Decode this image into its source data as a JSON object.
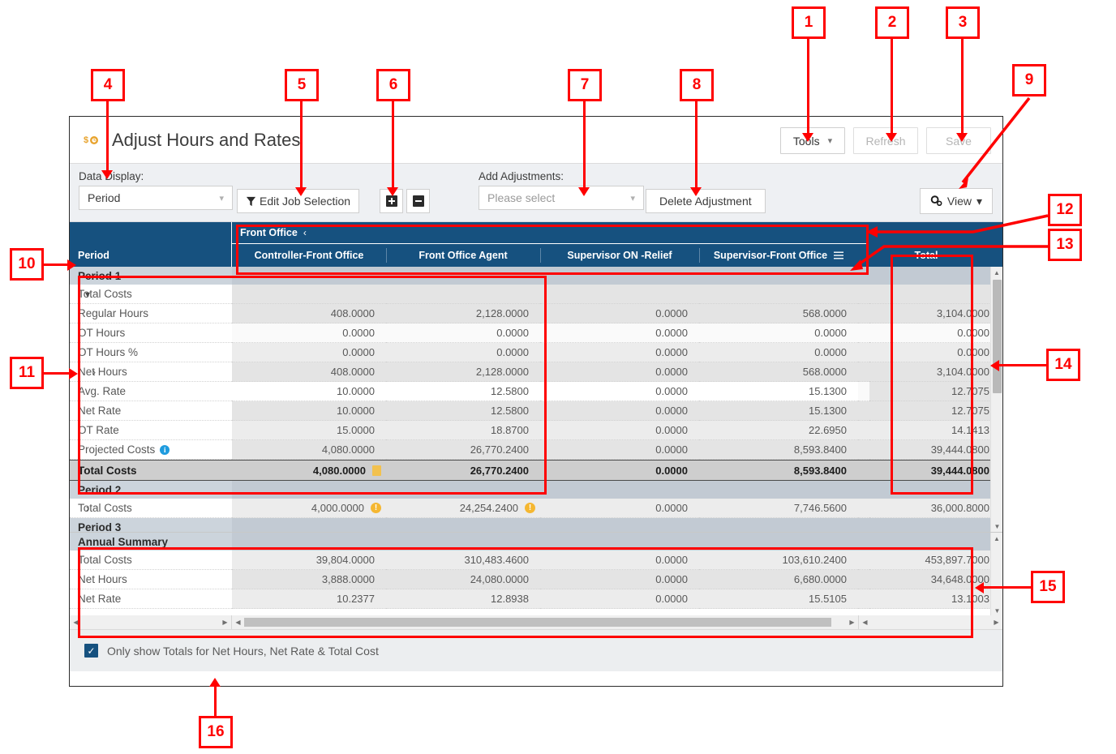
{
  "window": {
    "title": "Adjust Hours and Rates",
    "title_icon": "dollar-clock-icon"
  },
  "titlebar_buttons": {
    "tools": "Tools",
    "refresh": "Refresh",
    "save": "Save"
  },
  "toolbar": {
    "data_display_label": "Data Display:",
    "data_display_value": "Period",
    "edit_job_selection": "Edit Job Selection",
    "add_button_icon": "plus-square-icon",
    "remove_button_icon": "minus-square-icon",
    "add_adjustments_label": "Add Adjustments:",
    "add_adjustments_placeholder": "Please select",
    "delete_adjustment": "Delete Adjustment",
    "view": "View"
  },
  "grid": {
    "group_header": "Front Office",
    "group_collapse_icon": "chevron-left-icon",
    "columns": [
      "Period",
      "Controller-Front Office",
      "Front Office Agent",
      "Supervisor ON -Relief",
      "Supervisor-Front Office",
      "Total"
    ],
    "column_menu_icon": "hamburger-menu-icon",
    "sections": [
      {
        "name": "Period 1",
        "rows": [
          {
            "label": "Total Costs",
            "indent": "tc",
            "expander": "chevron-down-icon",
            "values": [
              "",
              "",
              "",
              "",
              ""
            ],
            "style": "totalcosts-head"
          },
          {
            "label": "Regular Hours",
            "indent": "2",
            "values": [
              "408.0000",
              "2,128.0000",
              "0.0000",
              "568.0000",
              "3,104.0000"
            ],
            "style": "alt"
          },
          {
            "label": "OT Hours",
            "indent": "2",
            "values": [
              "0.0000",
              "0.0000",
              "0.0000",
              "0.0000",
              "0.0000"
            ],
            "style": "white"
          },
          {
            "label": "OT Hours %",
            "indent": "2",
            "values": [
              "0.0000",
              "0.0000",
              "0.0000",
              "0.0000",
              "0.0000"
            ],
            "style": "alt2"
          },
          {
            "label": "Net Hours",
            "indent": "2",
            "expander": "chevron-right-icon",
            "values": [
              "408.0000",
              "2,128.0000",
              "0.0000",
              "568.0000",
              "3,104.0000"
            ],
            "style": "alt"
          },
          {
            "label": "Avg. Rate",
            "indent": "2",
            "values": [
              "10.0000",
              "12.5800",
              "0.0000",
              "15.1300",
              "12.7075"
            ],
            "style": "white"
          },
          {
            "label": "Net Rate",
            "indent": "2",
            "values": [
              "10.0000",
              "12.5800",
              "0.0000",
              "15.1300",
              "12.7075"
            ],
            "style": "alt"
          },
          {
            "label": "OT Rate",
            "indent": "2",
            "values": [
              "15.0000",
              "18.8700",
              "0.0000",
              "22.6950",
              "14.1413"
            ],
            "style": "alt2"
          },
          {
            "label": "Projected Costs",
            "indent": "2",
            "info": true,
            "values": [
              "4,080.0000",
              "26,770.2400",
              "0.0000",
              "8,593.8400",
              "39,444.0800"
            ],
            "style": "alt"
          },
          {
            "label": "Total Costs",
            "indent": "tc",
            "values": [
              "4,080.0000",
              "26,770.2400",
              "0.0000",
              "8,593.8400",
              "39,444.0800"
            ],
            "style": "bold-total",
            "marks": [
              "yellow-square",
              "",
              "",
              "",
              ""
            ]
          }
        ]
      },
      {
        "name": "Period 2",
        "rows": [
          {
            "label": "Total Costs",
            "indent": "tc",
            "expander": "chevron-right-icon",
            "values": [
              "4,000.0000",
              "24,254.2400",
              "0.0000",
              "7,746.5600",
              "36,000.8000"
            ],
            "style": "alt2",
            "marks": [
              "warning",
              "warning",
              "",
              "",
              ""
            ]
          }
        ]
      },
      {
        "name": "Period 3",
        "rows": []
      }
    ],
    "summary": {
      "name": "Annual Summary",
      "rows": [
        {
          "label": "Total Costs",
          "indent": "tc",
          "values": [
            "39,804.0000",
            "310,483.4600",
            "0.0000",
            "103,610.2400",
            "453,897.7000"
          ],
          "style": "alt2"
        },
        {
          "label": "Net Hours",
          "indent": "tc",
          "values": [
            "3,888.0000",
            "24,080.0000",
            "0.0000",
            "6,680.0000",
            "34,648.0000"
          ],
          "style": "alt"
        },
        {
          "label": "Net Rate",
          "indent": "tc",
          "values": [
            "10.2377",
            "12.8938",
            "0.0000",
            "15.5105",
            "13.1003"
          ],
          "style": "alt2"
        }
      ]
    }
  },
  "footer": {
    "checkbox_checked": true,
    "checkbox_label": "Only show Totals for Net Hours, Net Rate & Total Cost"
  },
  "callouts": [
    {
      "n": "1"
    },
    {
      "n": "2"
    },
    {
      "n": "3"
    },
    {
      "n": "4"
    },
    {
      "n": "5"
    },
    {
      "n": "6"
    },
    {
      "n": "7"
    },
    {
      "n": "8"
    },
    {
      "n": "9"
    },
    {
      "n": "10"
    },
    {
      "n": "11"
    },
    {
      "n": "12"
    },
    {
      "n": "13"
    },
    {
      "n": "14"
    },
    {
      "n": "15"
    },
    {
      "n": "16"
    }
  ],
  "colors": {
    "header_blue": "#16517f",
    "callout_red": "#ff0000",
    "accent_orange": "#e8a32d",
    "info_blue": "#1e9bde",
    "warning_yellow": "#f5b731"
  }
}
